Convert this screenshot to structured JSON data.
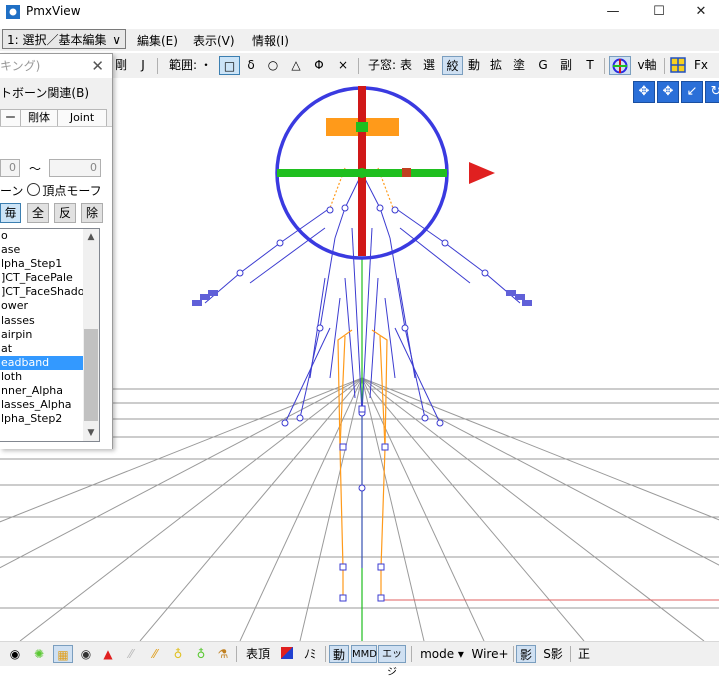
{
  "window": {
    "title": "PmxView"
  },
  "menubar": {
    "mode_select": "1: 選択／基本編集",
    "items": [
      "編集(E)",
      "表示(V)",
      "情報(I)"
    ]
  },
  "toolbar": {
    "items": [
      "剛",
      "J",
      "範囲:",
      "・",
      "□",
      "δ",
      "○",
      "△",
      "Φ",
      "×",
      "子窓:",
      "表",
      "選",
      "絞",
      "動",
      "拡",
      "塗",
      "G",
      "副",
      "T",
      "v軸",
      "Fx"
    ]
  },
  "panel": {
    "title": "キング)",
    "menu": "トボーン関連(B)",
    "tabs": [
      "ーン",
      "剛体",
      "Joint"
    ],
    "range_from": "0",
    "range_sep": "〜",
    "range_to": "0",
    "radio_bone_label": "ーン",
    "radio_vertex_label": "頂点モーフ",
    "buttons": [
      "毎",
      "全",
      "反",
      "除"
    ],
    "list_items": [
      "o",
      "ase",
      "lpha_Step1",
      "]CT_FacePale",
      "]CT_FaceShadow",
      "ower",
      "lasses",
      "airpin",
      "at",
      "eadband",
      "loth",
      "nner_Alpha",
      "lasses_Alpha",
      "lpha_Step2"
    ],
    "selected_item": "eadband"
  },
  "bottombar": {
    "items": [
      "表頂",
      "ﾉﾐ",
      "動",
      "MMD",
      "エッジ",
      "mode ▾",
      "Wire+",
      "影",
      "S影",
      "正"
    ]
  },
  "colors": {
    "gizmo_ring": "#3a3ae0",
    "axis_y": "#d01818",
    "axis_x": "#1fbf1f",
    "axis_arrow": "#e02020",
    "bone_wire": "#3b3bd0",
    "leg_bone": "#ff9a1a",
    "grid": "#9a9a9a",
    "selected": "#3399ff"
  }
}
